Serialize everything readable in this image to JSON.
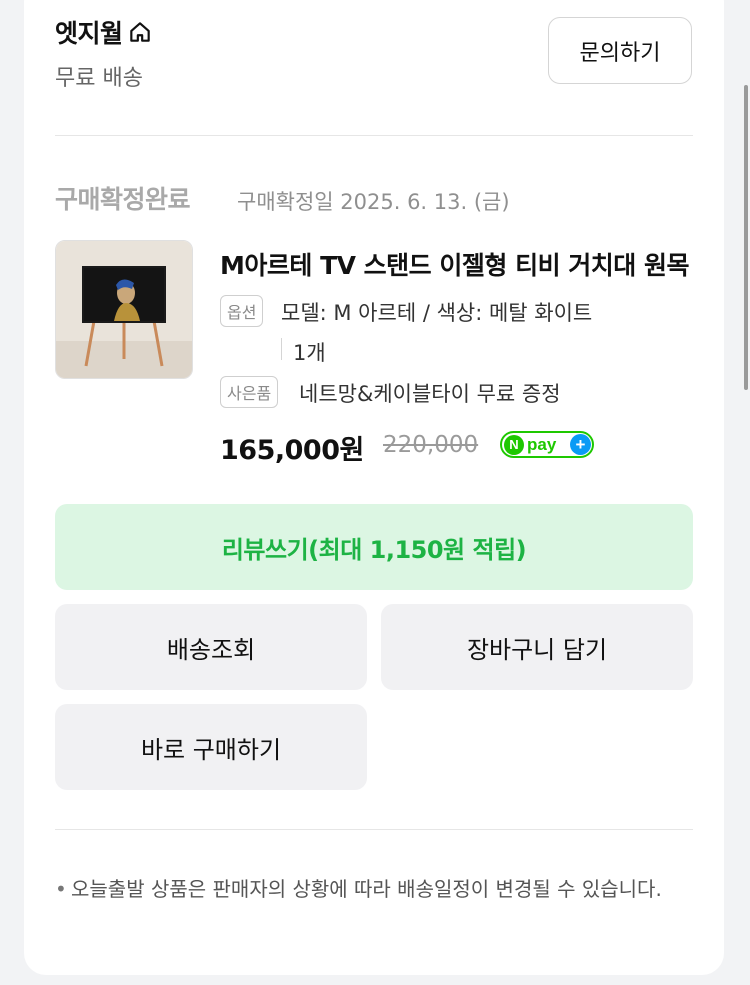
{
  "store": {
    "name": "엣지월",
    "icon": "home-icon",
    "shipping": "무료 배송",
    "inquiry_label": "문의하기"
  },
  "order": {
    "status": "구매확정완료",
    "confirm_date": "구매확정일 2025. 6. 13. (금)"
  },
  "product": {
    "title": "M아르테 TV 스탠드 이젤형 티비 거치대 원목",
    "option_tag": "옵션",
    "option_text": "모델: M 아르테 / 색상: 메탈 화이트",
    "quantity": "1개",
    "gift_tag": "사은품",
    "gift_text": "네트망&케이블타이 무료 증정",
    "price": "165,000원",
    "original_price": "220,000",
    "npay_label": "pay"
  },
  "actions": {
    "review_label": "리뷰쓰기(최대 1,150원 적립)",
    "tracking_label": "배송조회",
    "cart_label": "장바구니 담기",
    "buy_now_label": "바로 구매하기"
  },
  "notice": {
    "text": "오늘출발 상품은 판매자의 상황에 따라 배송일정이 변경될 수 있습니다."
  },
  "colors": {
    "accent_green": "#1db344",
    "review_bg": "#dcf6e3",
    "npay_green": "#1ec800",
    "npay_blue": "#0a9bf5"
  }
}
